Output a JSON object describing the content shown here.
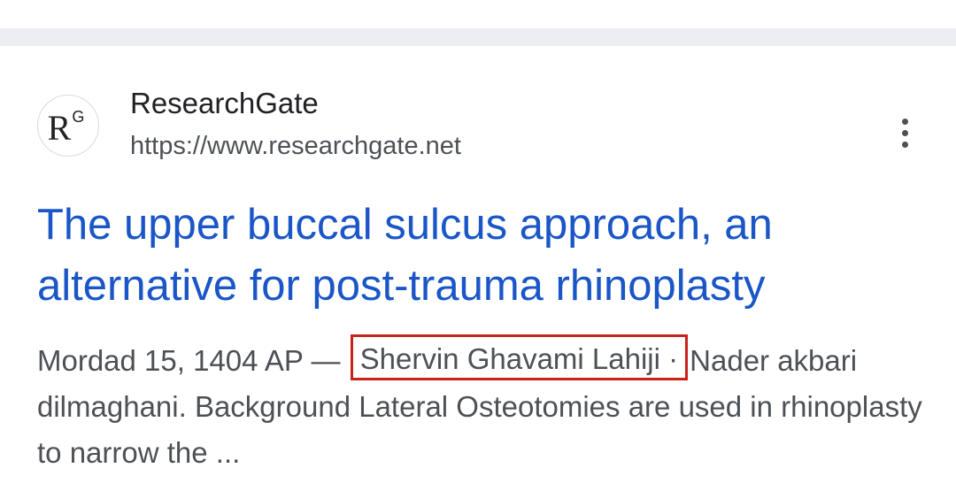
{
  "result": {
    "site_name": "ResearchGate",
    "site_url": "https://www.researchgate.net",
    "favicon_letter": "R",
    "favicon_superscript": "G",
    "title": "The upper buccal sulcus approach, an alternative for post-trauma rhinoplasty",
    "snippet": {
      "date": "Mordad 15, 1404 AP",
      "date_separator": " — ",
      "author_1": "Shervin Ghavami Lahiji",
      "author_separator": " · ",
      "rest": "Nader akbari dilmaghani. Background Lateral Osteotomies are used in rhinoplasty to narrow the ..."
    },
    "more_icon": "more-vert-icon"
  },
  "colors": {
    "title_link": "#1a56c7",
    "snippet_text": "#4d5156",
    "highlight_border": "#c8231b",
    "separator_bar": "#eceef1"
  }
}
